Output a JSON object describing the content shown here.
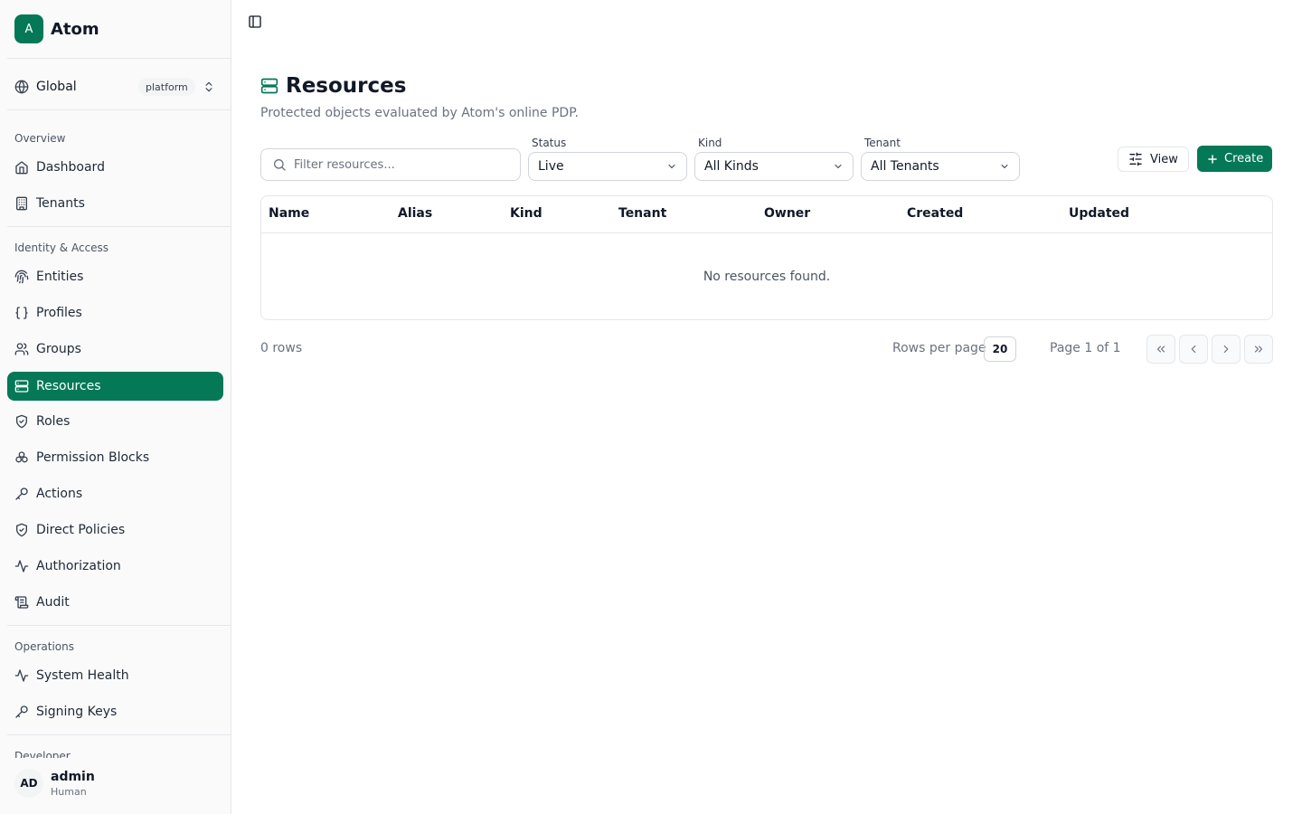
{
  "brand": {
    "logo_letter": "A",
    "name": "Atom"
  },
  "scope": {
    "label": "Global",
    "badge": "platform"
  },
  "sidebar": {
    "groups": [
      {
        "title": "Overview",
        "items": [
          {
            "label": "Dashboard",
            "icon": "home-icon"
          },
          {
            "label": "Tenants",
            "icon": "building-icon"
          }
        ]
      },
      {
        "title": "Identity & Access",
        "items": [
          {
            "label": "Entities",
            "icon": "fingerprint-icon"
          },
          {
            "label": "Profiles",
            "icon": "braces-icon"
          },
          {
            "label": "Groups",
            "icon": "users-icon"
          },
          {
            "label": "Resources",
            "icon": "server-icon",
            "active": true
          },
          {
            "label": "Roles",
            "icon": "shield-check-icon"
          },
          {
            "label": "Permission Blocks",
            "icon": "blocks-icon"
          },
          {
            "label": "Actions",
            "icon": "key-icon"
          },
          {
            "label": "Direct Policies",
            "icon": "shield-check-icon"
          },
          {
            "label": "Authorization",
            "icon": "activity-icon"
          },
          {
            "label": "Audit",
            "icon": "scroll-icon"
          }
        ]
      },
      {
        "title": "Operations",
        "items": [
          {
            "label": "System Health",
            "icon": "activity-icon"
          },
          {
            "label": "Signing Keys",
            "icon": "key-icon"
          }
        ]
      },
      {
        "title": "Developer",
        "items": []
      }
    ]
  },
  "user": {
    "initials": "AD",
    "name": "admin",
    "kind": "Human"
  },
  "main": {
    "title": "Resources",
    "subtitle": "Protected objects evaluated by Atom's online PDP.",
    "search": {
      "placeholder": "Filter resources..."
    },
    "filters": {
      "status": {
        "label": "Status",
        "value": "Live"
      },
      "kind": {
        "label": "Kind",
        "value": "All Kinds"
      },
      "tenant": {
        "label": "Tenant",
        "value": "All Tenants"
      }
    },
    "view_label": "View",
    "create_label": "Create",
    "table": {
      "columns": [
        "Name",
        "Alias",
        "Kind",
        "Tenant",
        "Owner",
        "Created",
        "Updated"
      ],
      "rows": [],
      "empty_text": "No resources found."
    },
    "footer": {
      "rows_text": "0 rows",
      "rows_per_page_label": "Rows per page",
      "rows_per_page_value": "20",
      "page_text": "Page 1 of 1"
    }
  },
  "colors": {
    "accent": "#047857",
    "border": "#e5e7eb",
    "muted": "#6b7280"
  }
}
